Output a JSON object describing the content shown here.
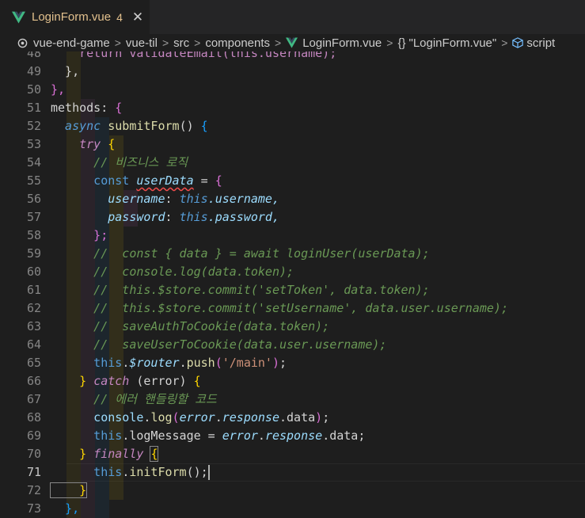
{
  "tab": {
    "label": "LoginForm.vue",
    "badge": "4",
    "close": "✕",
    "icon": "vue-logo-icon"
  },
  "breadcrumbs": {
    "items": [
      "vue-end-game",
      "vue-til",
      "src",
      "components",
      "LoginForm.vue",
      "\"LoginForm.vue\"",
      "script"
    ],
    "braces": "{}",
    "separator": ">"
  },
  "editor": {
    "active_line": "71",
    "lines": [
      {
        "n": "48",
        "tokens": [
          [
            "    return validateEmail(this.username);",
            "k-kw"
          ]
        ]
      },
      {
        "n": "49",
        "tokens": [
          [
            "  },",
            "k-plain"
          ]
        ]
      },
      {
        "n": "50",
        "tokens": [
          [
            "},",
            "k-br2"
          ]
        ]
      },
      {
        "n": "51",
        "tokens": [
          [
            "methods: ",
            "k-plain"
          ],
          [
            "{",
            "k-br2"
          ]
        ]
      },
      {
        "n": "52",
        "tokens": [
          [
            "  async ",
            "k-dec k-it"
          ],
          [
            "submitForm",
            "k-fn"
          ],
          [
            "() ",
            "k-plain"
          ],
          [
            "{",
            "k-br3"
          ]
        ]
      },
      {
        "n": "53",
        "tokens": [
          [
            "    try ",
            "k-kw k-it"
          ],
          [
            "{",
            "k-br"
          ]
        ]
      },
      {
        "n": "54",
        "tokens": [
          [
            "      // 비즈니스 로직",
            "k-cm k-it"
          ]
        ]
      },
      {
        "n": "55",
        "tokens": [
          [
            "      const ",
            "k-dec"
          ],
          [
            "userData",
            "k-var k-it squiggle"
          ],
          [
            " = ",
            "k-plain"
          ],
          [
            "{",
            "k-br2"
          ]
        ]
      },
      {
        "n": "56",
        "tokens": [
          [
            "        username",
            "k-var k-it"
          ],
          [
            ": ",
            "k-plain"
          ],
          [
            "this",
            "k-dec k-it"
          ],
          [
            ".username,",
            "k-var k-it"
          ]
        ]
      },
      {
        "n": "57",
        "tokens": [
          [
            "        password",
            "k-var k-it"
          ],
          [
            ": ",
            "k-plain"
          ],
          [
            "this",
            "k-dec k-it"
          ],
          [
            ".password,",
            "k-var k-it"
          ]
        ]
      },
      {
        "n": "58",
        "tokens": [
          [
            "      };",
            "k-br2"
          ]
        ]
      },
      {
        "n": "59",
        "tokens": [
          [
            "      //  const { data } = await loginUser(userData);",
            "k-cm k-it"
          ]
        ]
      },
      {
        "n": "60",
        "tokens": [
          [
            "      //  console.log(data.token);",
            "k-cm k-it"
          ]
        ]
      },
      {
        "n": "61",
        "tokens": [
          [
            "      //  this.$store.commit('setToken', data.token);",
            "k-cm k-it"
          ]
        ]
      },
      {
        "n": "62",
        "tokens": [
          [
            "      //  this.$store.commit('setUsername', data.user.username);",
            "k-cm k-it"
          ]
        ]
      },
      {
        "n": "63",
        "tokens": [
          [
            "      //  saveAuthToCookie(data.token);",
            "k-cm k-it"
          ]
        ]
      },
      {
        "n": "64",
        "tokens": [
          [
            "      //  saveUserToCookie(data.user.username);",
            "k-cm k-it"
          ]
        ]
      },
      {
        "n": "65",
        "tokens": [
          [
            "      this",
            "k-dec"
          ],
          [
            ".",
            "k-plain"
          ],
          [
            "$router",
            "k-var k-it"
          ],
          [
            ".",
            "k-plain"
          ],
          [
            "push",
            "k-fn"
          ],
          [
            "(",
            "k-br2"
          ],
          [
            "'/main'",
            "k-str"
          ],
          [
            ")",
            "k-br2"
          ],
          [
            ";",
            "k-plain"
          ]
        ]
      },
      {
        "n": "66",
        "tokens": [
          [
            "    } ",
            "k-br"
          ],
          [
            "catch ",
            "k-kw k-it"
          ],
          [
            "(error) ",
            "k-plain"
          ],
          [
            "{",
            "k-br"
          ]
        ]
      },
      {
        "n": "67",
        "tokens": [
          [
            "      // 에러 핸들링할 코드",
            "k-cm k-it"
          ]
        ]
      },
      {
        "n": "68",
        "tokens": [
          [
            "      console",
            "k-var"
          ],
          [
            ".",
            "k-plain"
          ],
          [
            "log",
            "k-fn"
          ],
          [
            "(",
            "k-br2"
          ],
          [
            "error",
            "k-var k-it"
          ],
          [
            ".",
            "k-plain"
          ],
          [
            "response",
            "k-var k-it"
          ],
          [
            ".data",
            "k-plain"
          ],
          [
            ")",
            "k-br2"
          ],
          [
            ";",
            "k-plain"
          ]
        ]
      },
      {
        "n": "69",
        "tokens": [
          [
            "      this",
            "k-dec"
          ],
          [
            ".logMessage = ",
            "k-plain"
          ],
          [
            "error",
            "k-var k-it"
          ],
          [
            ".",
            "k-plain"
          ],
          [
            "response",
            "k-var k-it"
          ],
          [
            ".data;",
            "k-plain"
          ]
        ]
      },
      {
        "n": "70",
        "tokens": [
          [
            "    } ",
            "k-br"
          ],
          [
            "finally ",
            "k-kw k-it"
          ],
          [
            "{",
            "k-br boxbr"
          ]
        ]
      },
      {
        "n": "71",
        "tokens": [
          [
            "      this",
            "k-dec"
          ],
          [
            ".",
            "k-plain"
          ],
          [
            "initForm",
            "k-fn"
          ],
          [
            "();",
            "k-plain"
          ]
        ]
      },
      {
        "n": "72",
        "tokens": [
          [
            "    }",
            "k-br boxbr"
          ]
        ]
      },
      {
        "n": "73",
        "tokens": [
          [
            "  },",
            "k-br3"
          ]
        ]
      }
    ]
  }
}
